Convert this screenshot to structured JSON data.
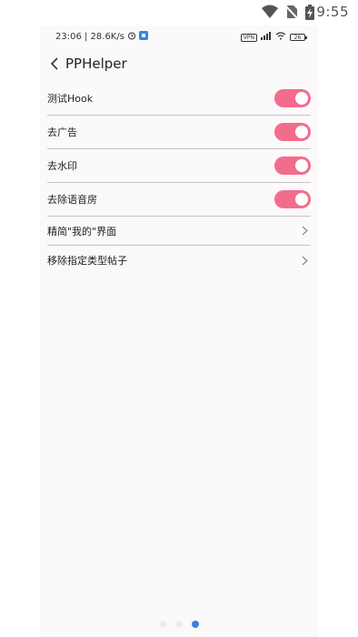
{
  "system_status": {
    "time": "9:55"
  },
  "device_status": {
    "time": "23:06 | 28.6K/s",
    "vpn": "VPN",
    "battery": "26"
  },
  "app_bar": {
    "title": "PPHelper"
  },
  "settings": [
    {
      "label": "测试Hook",
      "type": "toggle",
      "on": true
    },
    {
      "label": "去广告",
      "type": "toggle",
      "on": true
    },
    {
      "label": "去水印",
      "type": "toggle",
      "on": true
    },
    {
      "label": "去除语音房",
      "type": "toggle",
      "on": true
    },
    {
      "label": "精简\"我的\"界面",
      "type": "nav"
    },
    {
      "label": "移除指定类型帖子",
      "type": "nav"
    }
  ],
  "pager": {
    "count": 3,
    "active_index": 2
  },
  "colors": {
    "toggle_on": "#f26d8d",
    "pager_active": "#3d7fe0",
    "background": "#fcf9fa"
  }
}
